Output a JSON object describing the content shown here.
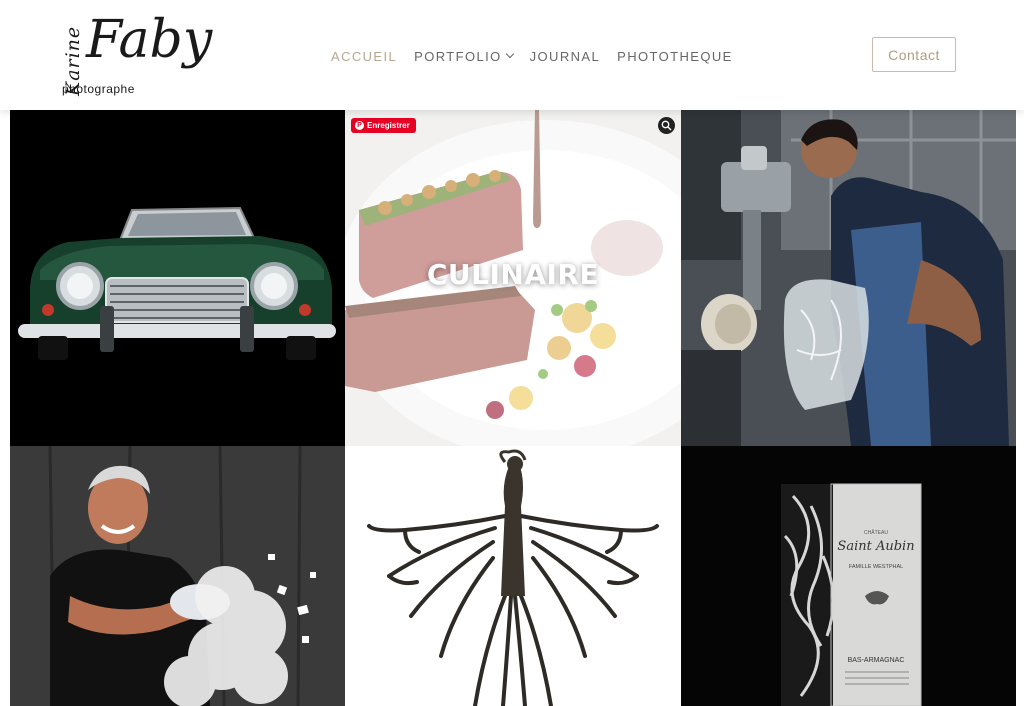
{
  "logo": {
    "first": "Karine",
    "last": "Faby",
    "sub": "photographe"
  },
  "nav": {
    "items": [
      {
        "label": "ACCUEIL",
        "active": true
      },
      {
        "label": "PORTFOLIO",
        "has_dropdown": true
      },
      {
        "label": "JOURNAL"
      },
      {
        "label": "PHOTOTHEQUE"
      }
    ],
    "contact_label": "Contact"
  },
  "colors": {
    "accent": "#b7a78f",
    "nav_text": "#666666",
    "pinterest": "#e60023"
  },
  "gallery": {
    "tiles": [
      {
        "name": "car",
        "label": ""
      },
      {
        "name": "culinaire",
        "label": "CULINAIRE",
        "pin_label": "Enregistrer"
      },
      {
        "name": "artisan",
        "label": ""
      },
      {
        "name": "man-plaster",
        "label": ""
      },
      {
        "name": "sculpture",
        "label": ""
      },
      {
        "name": "armagnac",
        "label": ""
      }
    ],
    "bottle_text": {
      "brand": "Saint Aubin",
      "top": "CHÂTEAU",
      "family": "FAMILLE WESTPHAL",
      "region": "BAS-ARMAGNAC"
    }
  }
}
